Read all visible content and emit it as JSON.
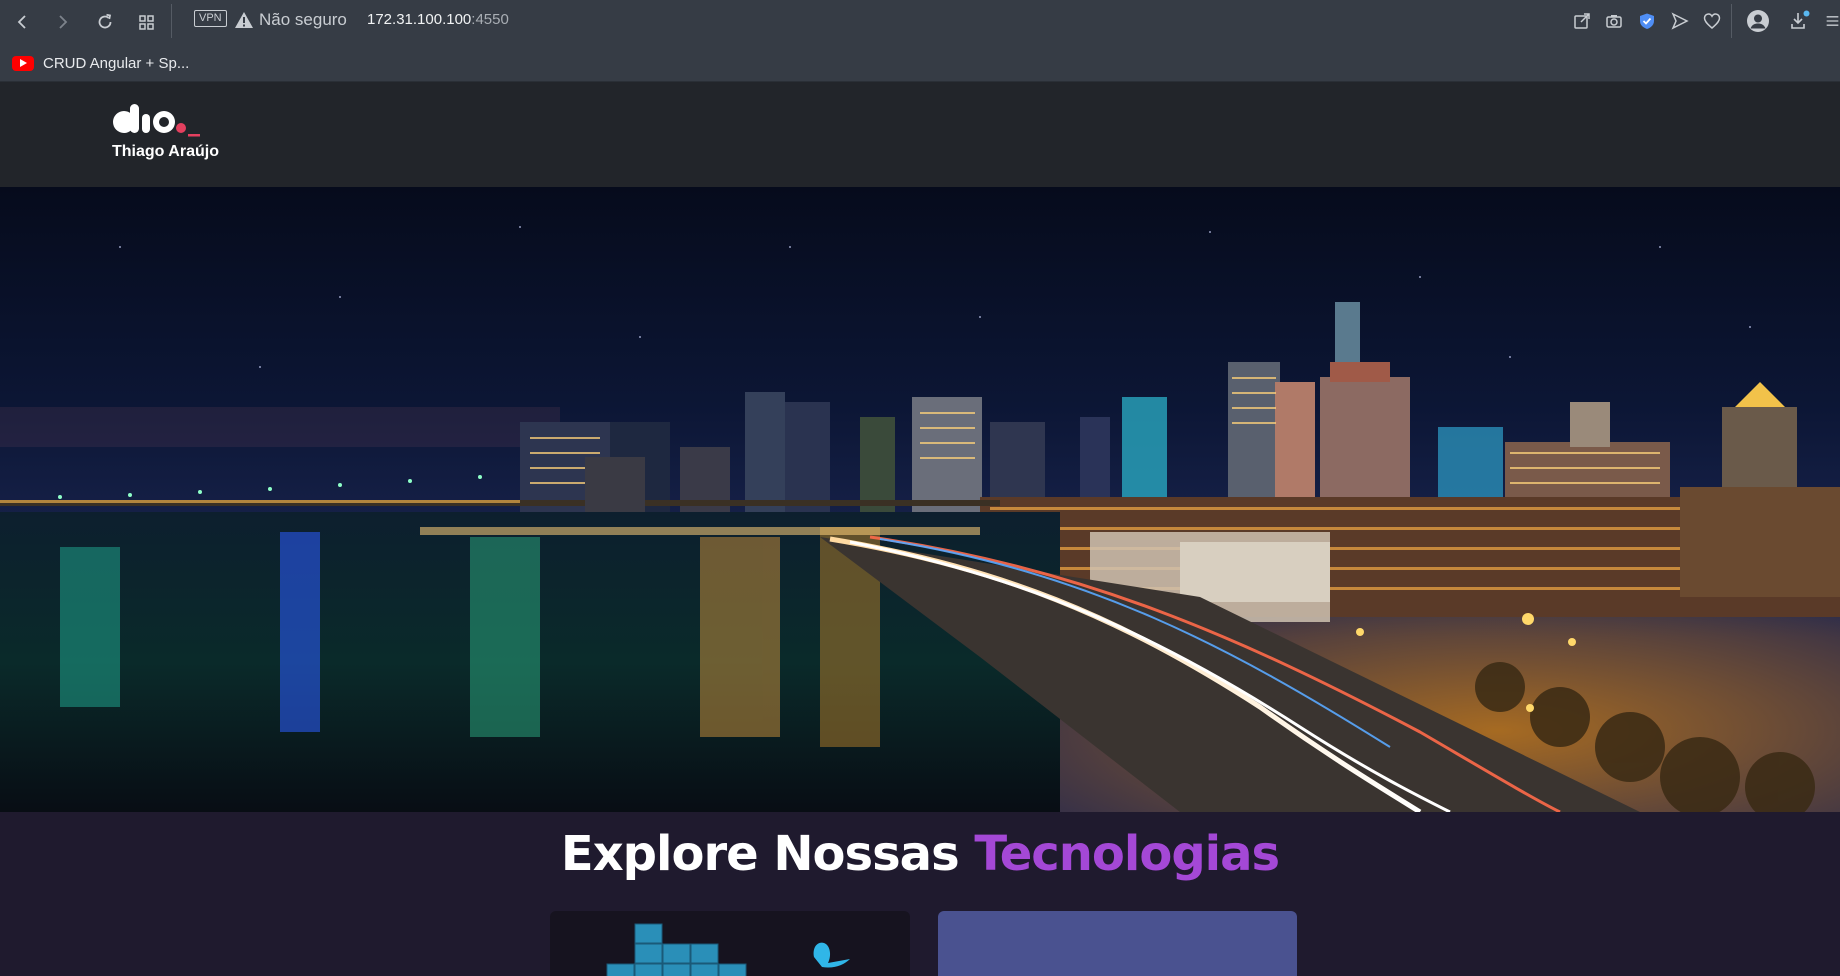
{
  "browser": {
    "vpn_label": "VPN",
    "security_label": "Não seguro",
    "url_host": "172.31.100.100",
    "url_port": ":4550",
    "bookmark": {
      "label": "CRUD Angular + Sp..."
    }
  },
  "site": {
    "logo_name": "Thiago Araújo"
  },
  "section": {
    "title_prefix": "Explore Nossas",
    "title_accent": "Tecnologias"
  },
  "colors": {
    "chrome_bg": "#363c45",
    "header_bg": "#22252a",
    "section_bg": "#1f1a2e",
    "accent_purple": "#a448d6",
    "card_blue": "#4a5290"
  }
}
